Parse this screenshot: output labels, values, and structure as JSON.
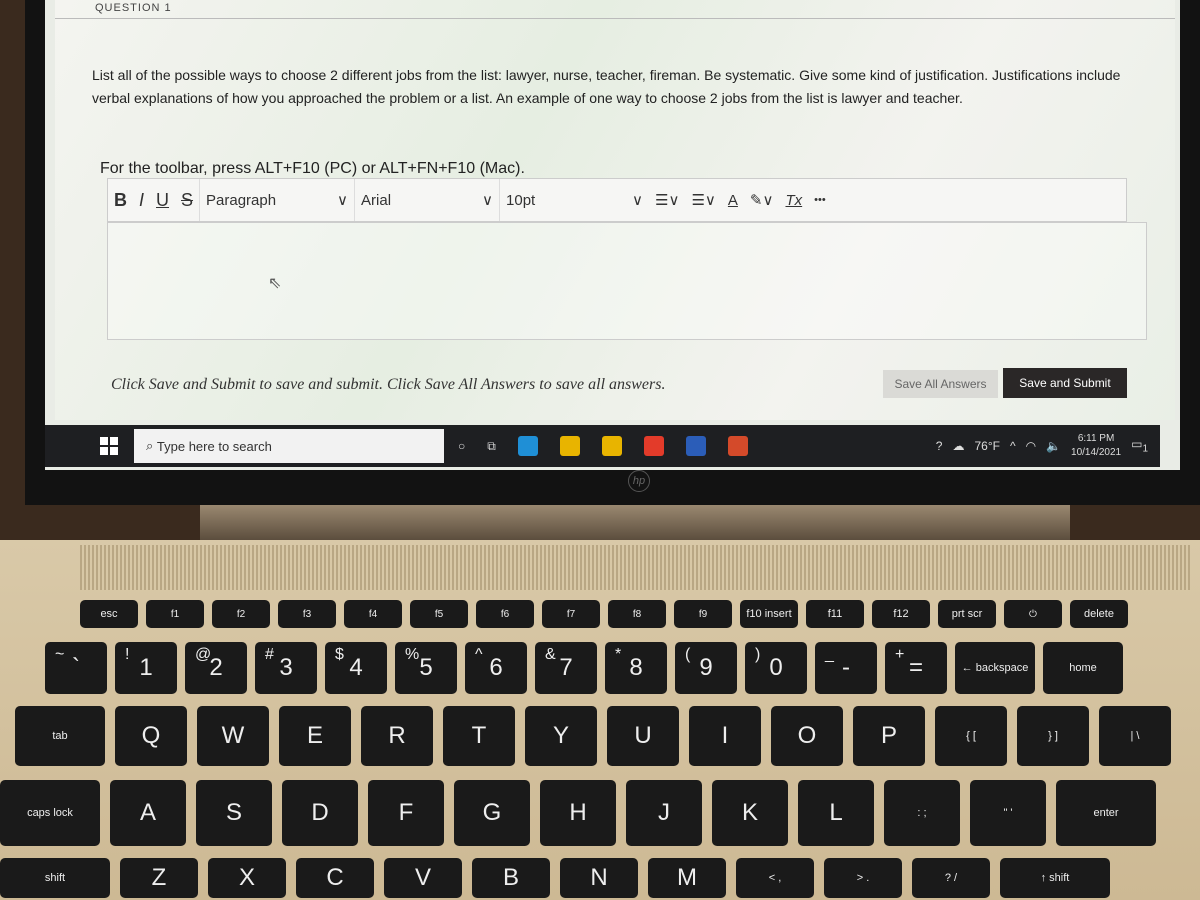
{
  "question": {
    "heading_fragment": "QUESTION 1",
    "prompt": "List all of the possible ways to choose 2 different jobs from the list:  lawyer, nurse, teacher, fireman.  Be systematic.  Give some kind of justification.  Justifications include verbal explanations of how you approached the problem or a list.  An example of one way to choose 2 jobs from the list is lawyer and teacher."
  },
  "editor": {
    "toolbar_hint": "For the toolbar, press ALT+F10 (PC) or ALT+FN+F10 (Mac).",
    "bold": "B",
    "italic": "I",
    "underline": "U",
    "strike": "S",
    "block_format": "Paragraph",
    "font": "Arial",
    "size": "10pt",
    "font_color": "A",
    "clear_format": "Tx",
    "more": "•••",
    "chevron": "∨",
    "value": ""
  },
  "footer": {
    "note": "Click Save and Submit to save and submit. Click Save All Answers to save all answers.",
    "save_all": "Save All Answers",
    "save_submit": "Save and Submit"
  },
  "taskbar": {
    "search_placeholder": "Type here to search",
    "weather": "76°F",
    "time": "6:11 PM",
    "date": "10/14/2021",
    "notifications": "1",
    "app_colors": [
      "#1f8fd6",
      "#e8b400",
      "#e8b400",
      "#e33b2a",
      "#2b5db8",
      "#d44a2a"
    ]
  },
  "laptop": {
    "brand": "hp"
  },
  "keyboard": {
    "fn_row": [
      "esc",
      "f1",
      "f2",
      "f3",
      "f4",
      "f5",
      "f6",
      "f7",
      "f8",
      "f9",
      "f10 insert",
      "f11",
      "f12",
      "prt scr",
      "⏻",
      "delete"
    ],
    "number_row": [
      [
        "~",
        "`"
      ],
      [
        "!",
        "1"
      ],
      [
        "@",
        "2"
      ],
      [
        "#",
        "3"
      ],
      [
        "$",
        "4"
      ],
      [
        "%",
        "5"
      ],
      [
        "^",
        "6"
      ],
      [
        "&",
        "7"
      ],
      [
        "*",
        "8"
      ],
      [
        "(",
        "9"
      ],
      [
        ")",
        "0"
      ],
      [
        "_",
        "-"
      ],
      [
        "+",
        "="
      ],
      [
        "",
        "← backspace"
      ],
      [
        "",
        "home"
      ]
    ],
    "qwerty_row": [
      "tab",
      "Q",
      "W",
      "E",
      "R",
      "T",
      "Y",
      "U",
      "I",
      "O",
      "P",
      "{ [",
      "} ]",
      "| \\"
    ],
    "home_row": [
      "caps lock",
      "A",
      "S",
      "D",
      "F",
      "G",
      "H",
      "J",
      "K",
      "L",
      ": ;",
      "\" '",
      "enter"
    ],
    "bottom_row": [
      "shift",
      "Z",
      "X",
      "C",
      "V",
      "B",
      "N",
      "M",
      "< ,",
      "> .",
      "? /",
      "↑ shift"
    ]
  }
}
